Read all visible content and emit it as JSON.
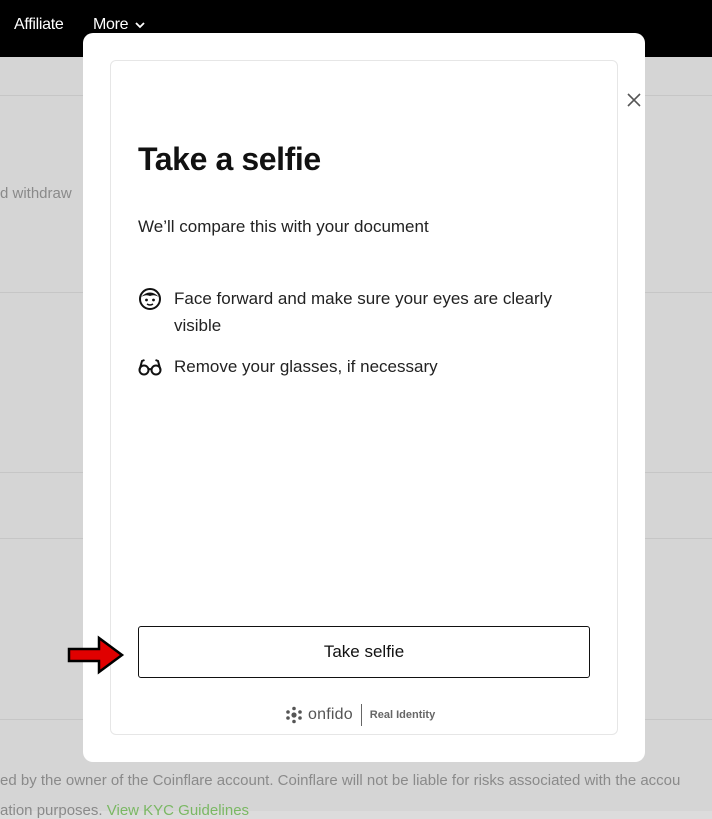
{
  "nav": {
    "affiliate": "Affiliate",
    "more": "More"
  },
  "background": {
    "partial_text": "d withdraw",
    "disclaimer": "ed by the owner of the Coinflare account. Coinflare will not be liable for risks associated with the accou",
    "bottom_fragment": "ation purposes.",
    "bottom_link": "View KYC Guidelines"
  },
  "modal": {
    "title": "Take a selfie",
    "subtitle": "We’ll compare this with your document",
    "tips": [
      {
        "icon": "face-icon",
        "text": "Face forward and make sure your eyes are clearly visible"
      },
      {
        "icon": "glasses-icon",
        "text": "Remove your glasses, if necessary"
      }
    ],
    "button_label": "Take selfie",
    "footer": {
      "brand": "onfido",
      "tagline": "Real Identity"
    }
  },
  "colors": {
    "topbar": "#000000",
    "overlay_bg": "#d5d5d5",
    "annotation_arrow": "#e00000",
    "link": "#7ab863"
  }
}
